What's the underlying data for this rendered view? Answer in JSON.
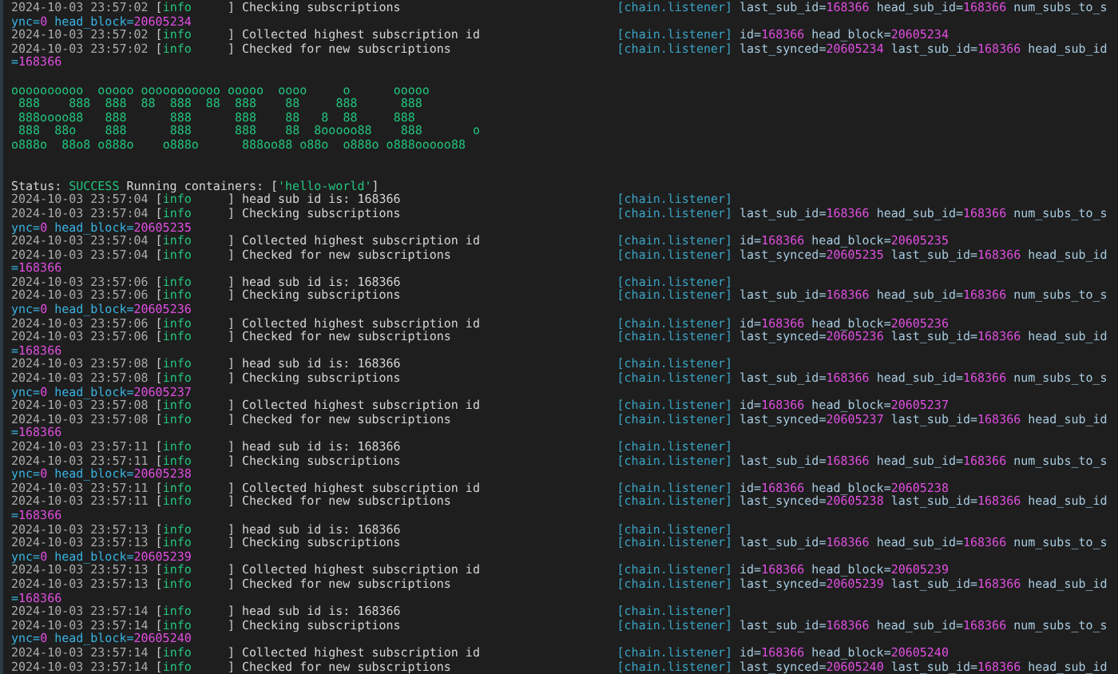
{
  "lines": [
    {
      "kind": "log",
      "time": "2024-10-03 23:57:02",
      "open": "[",
      "level": "info",
      "close": "]",
      "message": "Checking subscriptions",
      "logger": "[chain.listener]",
      "fields": [
        {
          "key": "last_sub_id=",
          "value": "168366"
        },
        {
          "key": "head_sub_id=",
          "value": "168366"
        },
        {
          "key": "num_subs_to_s"
        }
      ]
    },
    {
      "kind": "wrap",
      "fields": [
        {
          "key": "ync=",
          "value": "0"
        },
        {
          "key": "head_block=",
          "value": "20605234"
        }
      ]
    },
    {
      "kind": "log",
      "time": "2024-10-03 23:57:02",
      "open": "[",
      "level": "info",
      "close": "]",
      "message": "Collected highest subscription id",
      "logger": "[chain.listener]",
      "fields": [
        {
          "key": "id=",
          "value": "168366"
        },
        {
          "key": "head_block=",
          "value": "20605234"
        }
      ]
    },
    {
      "kind": "log",
      "time": "2024-10-03 23:57:02",
      "open": "[",
      "level": "info",
      "close": "]",
      "message": "Checked for new subscriptions",
      "logger": "[chain.listener]",
      "fields": [
        {
          "key": "last_synced=",
          "value": "20605234"
        },
        {
          "key": "last_sub_id=",
          "value": "168366"
        },
        {
          "key": "head_sub_id"
        }
      ]
    },
    {
      "kind": "wrap",
      "fields": [
        {
          "key": "=",
          "value": "168366"
        }
      ]
    },
    {
      "kind": "blank"
    },
    {
      "kind": "banner",
      "rows": [
        "oooooooooo  ooooo ooooooooooo ooooo  oooo     o      ooooo",
        " 888    888  888  88  888  88  888    88     888      888",
        " 888oooo88   888      888      888    88   8  88     888",
        " 888  88o    888      888      888    88  8ooooo88    888       o",
        "o888o  88o8 o888o    o888o      888oo88 o88o  o888o o888ooooo88"
      ]
    },
    {
      "kind": "blank"
    },
    {
      "kind": "blank"
    },
    {
      "kind": "status",
      "label": "Status:",
      "result": "SUCCESS",
      "message": "Running containers:",
      "open": "[",
      "containers": [
        "'hello-world'"
      ],
      "close": "]"
    },
    {
      "kind": "log",
      "time": "2024-10-03 23:57:04",
      "open": "[",
      "level": "info",
      "close": "]",
      "message": "head sub id is: 168366",
      "logger": "[chain.listener]"
    },
    {
      "kind": "log",
      "time": "2024-10-03 23:57:04",
      "open": "[",
      "level": "info",
      "close": "]",
      "message": "Checking subscriptions",
      "logger": "[chain.listener]",
      "fields": [
        {
          "key": "last_sub_id=",
          "value": "168366"
        },
        {
          "key": "head_sub_id=",
          "value": "168366"
        },
        {
          "key": "num_subs_to_s"
        }
      ]
    },
    {
      "kind": "wrap",
      "fields": [
        {
          "key": "ync=",
          "value": "0"
        },
        {
          "key": "head_block=",
          "value": "20605235"
        }
      ]
    },
    {
      "kind": "log",
      "time": "2024-10-03 23:57:04",
      "open": "[",
      "level": "info",
      "close": "]",
      "message": "Collected highest subscription id",
      "logger": "[chain.listener]",
      "fields": [
        {
          "key": "id=",
          "value": "168366"
        },
        {
          "key": "head_block=",
          "value": "20605235"
        }
      ]
    },
    {
      "kind": "log",
      "time": "2024-10-03 23:57:04",
      "open": "[",
      "level": "info",
      "close": "]",
      "message": "Checked for new subscriptions",
      "logger": "[chain.listener]",
      "fields": [
        {
          "key": "last_synced=",
          "value": "20605235"
        },
        {
          "key": "last_sub_id=",
          "value": "168366"
        },
        {
          "key": "head_sub_id"
        }
      ]
    },
    {
      "kind": "wrap",
      "fields": [
        {
          "key": "=",
          "value": "168366"
        }
      ]
    },
    {
      "kind": "log",
      "time": "2024-10-03 23:57:06",
      "open": "[",
      "level": "info",
      "close": "]",
      "message": "head sub id is: 168366",
      "logger": "[chain.listener]"
    },
    {
      "kind": "log",
      "time": "2024-10-03 23:57:06",
      "open": "[",
      "level": "info",
      "close": "]",
      "message": "Checking subscriptions",
      "logger": "[chain.listener]",
      "fields": [
        {
          "key": "last_sub_id=",
          "value": "168366"
        },
        {
          "key": "head_sub_id=",
          "value": "168366"
        },
        {
          "key": "num_subs_to_s"
        }
      ]
    },
    {
      "kind": "wrap",
      "fields": [
        {
          "key": "ync=",
          "value": "0"
        },
        {
          "key": "head_block=",
          "value": "20605236"
        }
      ]
    },
    {
      "kind": "log",
      "time": "2024-10-03 23:57:06",
      "open": "[",
      "level": "info",
      "close": "]",
      "message": "Collected highest subscription id",
      "logger": "[chain.listener]",
      "fields": [
        {
          "key": "id=",
          "value": "168366"
        },
        {
          "key": "head_block=",
          "value": "20605236"
        }
      ]
    },
    {
      "kind": "log",
      "time": "2024-10-03 23:57:06",
      "open": "[",
      "level": "info",
      "close": "]",
      "message": "Checked for new subscriptions",
      "logger": "[chain.listener]",
      "fields": [
        {
          "key": "last_synced=",
          "value": "20605236"
        },
        {
          "key": "last_sub_id=",
          "value": "168366"
        },
        {
          "key": "head_sub_id"
        }
      ]
    },
    {
      "kind": "wrap",
      "fields": [
        {
          "key": "=",
          "value": "168366"
        }
      ]
    },
    {
      "kind": "log",
      "time": "2024-10-03 23:57:08",
      "open": "[",
      "level": "info",
      "close": "]",
      "message": "head sub id is: 168366",
      "logger": "[chain.listener]"
    },
    {
      "kind": "log",
      "time": "2024-10-03 23:57:08",
      "open": "[",
      "level": "info",
      "close": "]",
      "message": "Checking subscriptions",
      "logger": "[chain.listener]",
      "fields": [
        {
          "key": "last_sub_id=",
          "value": "168366"
        },
        {
          "key": "head_sub_id=",
          "value": "168366"
        },
        {
          "key": "num_subs_to_s"
        }
      ]
    },
    {
      "kind": "wrap",
      "fields": [
        {
          "key": "ync=",
          "value": "0"
        },
        {
          "key": "head_block=",
          "value": "20605237"
        }
      ]
    },
    {
      "kind": "log",
      "time": "2024-10-03 23:57:08",
      "open": "[",
      "level": "info",
      "close": "]",
      "message": "Collected highest subscription id",
      "logger": "[chain.listener]",
      "fields": [
        {
          "key": "id=",
          "value": "168366"
        },
        {
          "key": "head_block=",
          "value": "20605237"
        }
      ]
    },
    {
      "kind": "log",
      "time": "2024-10-03 23:57:08",
      "open": "[",
      "level": "info",
      "close": "]",
      "message": "Checked for new subscriptions",
      "logger": "[chain.listener]",
      "fields": [
        {
          "key": "last_synced=",
          "value": "20605237"
        },
        {
          "key": "last_sub_id=",
          "value": "168366"
        },
        {
          "key": "head_sub_id"
        }
      ]
    },
    {
      "kind": "wrap",
      "fields": [
        {
          "key": "=",
          "value": "168366"
        }
      ]
    },
    {
      "kind": "log",
      "time": "2024-10-03 23:57:11",
      "open": "[",
      "level": "info",
      "close": "]",
      "message": "head sub id is: 168366",
      "logger": "[chain.listener]"
    },
    {
      "kind": "log",
      "time": "2024-10-03 23:57:11",
      "open": "[",
      "level": "info",
      "close": "]",
      "message": "Checking subscriptions",
      "logger": "[chain.listener]",
      "fields": [
        {
          "key": "last_sub_id=",
          "value": "168366"
        },
        {
          "key": "head_sub_id=",
          "value": "168366"
        },
        {
          "key": "num_subs_to_s"
        }
      ]
    },
    {
      "kind": "wrap",
      "fields": [
        {
          "key": "ync=",
          "value": "0"
        },
        {
          "key": "head_block=",
          "value": "20605238"
        }
      ]
    },
    {
      "kind": "log",
      "time": "2024-10-03 23:57:11",
      "open": "[",
      "level": "info",
      "close": "]",
      "message": "Collected highest subscription id",
      "logger": "[chain.listener]",
      "fields": [
        {
          "key": "id=",
          "value": "168366"
        },
        {
          "key": "head_block=",
          "value": "20605238"
        }
      ]
    },
    {
      "kind": "log",
      "time": "2024-10-03 23:57:11",
      "open": "[",
      "level": "info",
      "close": "]",
      "message": "Checked for new subscriptions",
      "logger": "[chain.listener]",
      "fields": [
        {
          "key": "last_synced=",
          "value": "20605238"
        },
        {
          "key": "last_sub_id=",
          "value": "168366"
        },
        {
          "key": "head_sub_id"
        }
      ]
    },
    {
      "kind": "wrap",
      "fields": [
        {
          "key": "=",
          "value": "168366"
        }
      ]
    },
    {
      "kind": "log",
      "time": "2024-10-03 23:57:13",
      "open": "[",
      "level": "info",
      "close": "]",
      "message": "head sub id is: 168366",
      "logger": "[chain.listener]"
    },
    {
      "kind": "log",
      "time": "2024-10-03 23:57:13",
      "open": "[",
      "level": "info",
      "close": "]",
      "message": "Checking subscriptions",
      "logger": "[chain.listener]",
      "fields": [
        {
          "key": "last_sub_id=",
          "value": "168366"
        },
        {
          "key": "head_sub_id=",
          "value": "168366"
        },
        {
          "key": "num_subs_to_s"
        }
      ]
    },
    {
      "kind": "wrap",
      "fields": [
        {
          "key": "ync=",
          "value": "0"
        },
        {
          "key": "head_block=",
          "value": "20605239"
        }
      ]
    },
    {
      "kind": "log",
      "time": "2024-10-03 23:57:13",
      "open": "[",
      "level": "info",
      "close": "]",
      "message": "Collected highest subscription id",
      "logger": "[chain.listener]",
      "fields": [
        {
          "key": "id=",
          "value": "168366"
        },
        {
          "key": "head_block=",
          "value": "20605239"
        }
      ]
    },
    {
      "kind": "log",
      "time": "2024-10-03 23:57:13",
      "open": "[",
      "level": "info",
      "close": "]",
      "message": "Checked for new subscriptions",
      "logger": "[chain.listener]",
      "fields": [
        {
          "key": "last_synced=",
          "value": "20605239"
        },
        {
          "key": "last_sub_id=",
          "value": "168366"
        },
        {
          "key": "head_sub_id"
        }
      ]
    },
    {
      "kind": "wrap",
      "fields": [
        {
          "key": "=",
          "value": "168366"
        }
      ]
    },
    {
      "kind": "log",
      "time": "2024-10-03 23:57:14",
      "open": "[",
      "level": "info",
      "close": "]",
      "message": "head sub id is: 168366",
      "logger": "[chain.listener]"
    },
    {
      "kind": "log",
      "time": "2024-10-03 23:57:14",
      "open": "[",
      "level": "info",
      "close": "]",
      "message": "Checking subscriptions",
      "logger": "[chain.listener]",
      "fields": [
        {
          "key": "last_sub_id=",
          "value": "168366"
        },
        {
          "key": "head_sub_id=",
          "value": "168366"
        },
        {
          "key": "num_subs_to_s"
        }
      ]
    },
    {
      "kind": "wrap",
      "fields": [
        {
          "key": "ync=",
          "value": "0"
        },
        {
          "key": "head_block=",
          "value": "20605240"
        }
      ]
    },
    {
      "kind": "log",
      "time": "2024-10-03 23:57:14",
      "open": "[",
      "level": "info",
      "close": "]",
      "message": "Collected highest subscription id",
      "logger": "[chain.listener]",
      "fields": [
        {
          "key": "id=",
          "value": "168366"
        },
        {
          "key": "head_block=",
          "value": "20605240"
        }
      ]
    },
    {
      "kind": "log",
      "time": "2024-10-03 23:57:14",
      "open": "[",
      "level": "info",
      "close": "]",
      "message": "Checked for new subscriptions",
      "logger": "[chain.listener]",
      "fields": [
        {
          "key": "last_synced=",
          "value": "20605240"
        },
        {
          "key": "last_sub_id=",
          "value": "168366"
        },
        {
          "key": "head_sub_id"
        }
      ]
    }
  ]
}
